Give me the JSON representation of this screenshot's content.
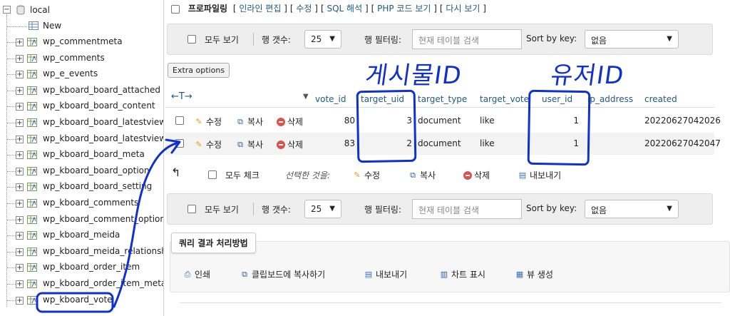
{
  "nav": {
    "root": "local",
    "new_label": "New",
    "tables": [
      "wp_commentmeta",
      "wp_comments",
      "wp_e_events",
      "wp_kboard_board_attached",
      "wp_kboard_board_content",
      "wp_kboard_board_latestview",
      "wp_kboard_board_latestview",
      "wp_kboard_board_meta",
      "wp_kboard_board_option",
      "wp_kboard_board_setting",
      "wp_kboard_comments",
      "wp_kboard_comment_option",
      "wp_kboard_meida",
      "wp_kboard_meida_relationsh",
      "wp_kboard_order_item",
      "wp_kboard_order_item_meta",
      "wp_kboard_vote"
    ]
  },
  "top_links": {
    "profiling": "프로파일링",
    "links": [
      "인라인 편집",
      "수정",
      "SQL 해석",
      "PHP 코드 보기",
      "다시 보기"
    ]
  },
  "filter_bar": {
    "show_all": "모두 보기",
    "row_count_label": "행 갯수:",
    "row_count_value": "25",
    "row_filter_label": "행 필터링:",
    "search_placeholder": "현재 테이블 검색",
    "sort_label": "Sort by key:",
    "sort_value": "없음"
  },
  "extra_options": "Extra options",
  "table": {
    "columns": [
      "vote_id",
      "target_uid",
      "target_type",
      "target_vote",
      "user_id",
      "ip_address",
      "created"
    ],
    "rows": [
      {
        "vote_id": "80",
        "target_uid": "3",
        "target_type": "document",
        "target_vote": "like",
        "user_id": "1",
        "ip_address": "",
        "created": "20220627042026"
      },
      {
        "vote_id": "83",
        "target_uid": "2",
        "target_type": "document",
        "target_vote": "like",
        "user_id": "1",
        "ip_address": "",
        "created": "20220627042047"
      }
    ],
    "row_actions": {
      "edit": "수정",
      "copy": "복사",
      "delete": "삭제"
    }
  },
  "bulk": {
    "check_all": "모두 체크",
    "with_selected": "선택한 것을:",
    "edit": "수정",
    "copy": "복사",
    "delete": "삭제",
    "export": "내보내기"
  },
  "query_ops": {
    "title": "쿼리 결과 처리방법",
    "print": "인쇄",
    "copy_clipboard": "클립보드에 복사하기",
    "export": "내보내기",
    "chart": "차트 표시",
    "view": "뷰 생성"
  },
  "annotations": {
    "post_id": "게시물ID",
    "user_id": "유저ID"
  },
  "colors": {
    "link": "#235a81",
    "annotation": "#1030d0",
    "panel_bg": "#eeeeee"
  }
}
